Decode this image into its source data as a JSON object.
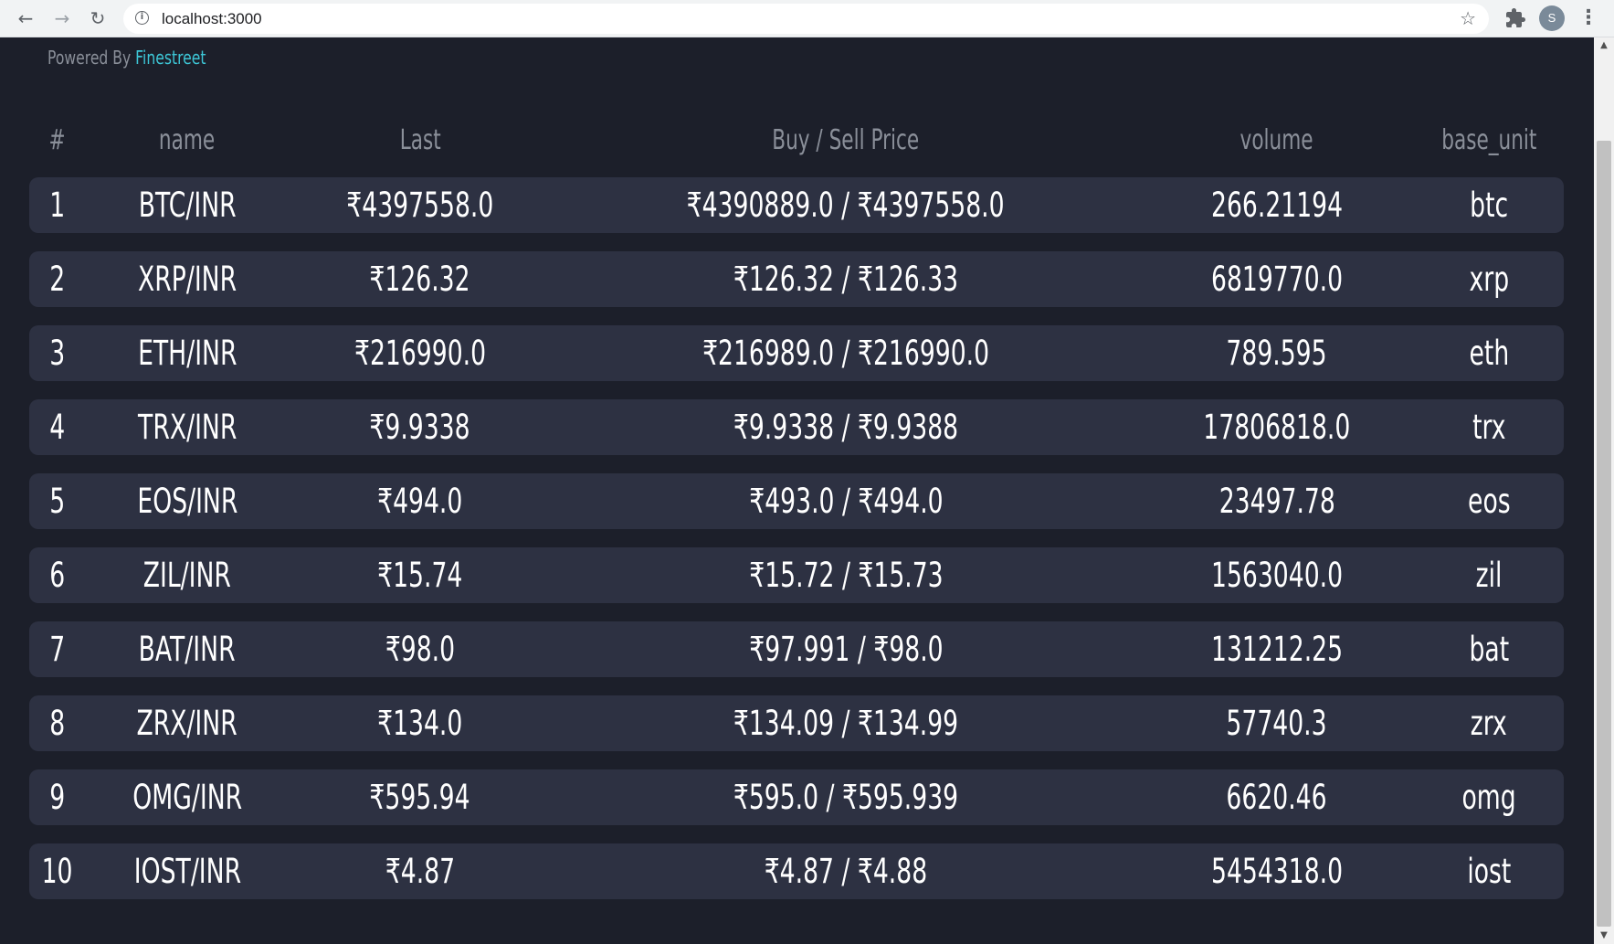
{
  "browser": {
    "url": "localhost:3000",
    "avatar_letter": "S"
  },
  "page": {
    "powered_prefix": "Powered By ",
    "powered_brand": "Finestreet"
  },
  "table": {
    "headers": {
      "num": "#",
      "name": "name",
      "last": "Last",
      "price": "Buy / Sell Price",
      "volume": "volume",
      "base_unit": "base_unit"
    },
    "rows": [
      {
        "num": "1",
        "name": "BTC/INR",
        "last": "₹4397558.0",
        "price": "₹4390889.0 / ₹4397558.0",
        "volume": "266.21194",
        "base_unit": "btc"
      },
      {
        "num": "2",
        "name": "XRP/INR",
        "last": "₹126.32",
        "price": "₹126.32 / ₹126.33",
        "volume": "6819770.0",
        "base_unit": "xrp"
      },
      {
        "num": "3",
        "name": "ETH/INR",
        "last": "₹216990.0",
        "price": "₹216989.0 / ₹216990.0",
        "volume": "789.595",
        "base_unit": "eth"
      },
      {
        "num": "4",
        "name": "TRX/INR",
        "last": "₹9.9338",
        "price": "₹9.9338 / ₹9.9388",
        "volume": "17806818.0",
        "base_unit": "trx"
      },
      {
        "num": "5",
        "name": "EOS/INR",
        "last": "₹494.0",
        "price": "₹493.0 / ₹494.0",
        "volume": "23497.78",
        "base_unit": "eos"
      },
      {
        "num": "6",
        "name": "ZIL/INR",
        "last": "₹15.74",
        "price": "₹15.72 / ₹15.73",
        "volume": "1563040.0",
        "base_unit": "zil"
      },
      {
        "num": "7",
        "name": "BAT/INR",
        "last": "₹98.0",
        "price": "₹97.991 / ₹98.0",
        "volume": "131212.25",
        "base_unit": "bat"
      },
      {
        "num": "8",
        "name": "ZRX/INR",
        "last": "₹134.0",
        "price": "₹134.09 / ₹134.99",
        "volume": "57740.3",
        "base_unit": "zrx"
      },
      {
        "num": "9",
        "name": "OMG/INR",
        "last": "₹595.94",
        "price": "₹595.0 / ₹595.939",
        "volume": "6620.46",
        "base_unit": "omg"
      },
      {
        "num": "10",
        "name": "IOST/INR",
        "last": "₹4.87",
        "price": "₹4.87 / ₹4.88",
        "volume": "5454318.0",
        "base_unit": "iost"
      }
    ]
  },
  "colors": {
    "background": "#1c1f2a",
    "row_background": "#2d3142",
    "header_text": "#8a8f99",
    "brand_accent": "#3dc6d6"
  }
}
